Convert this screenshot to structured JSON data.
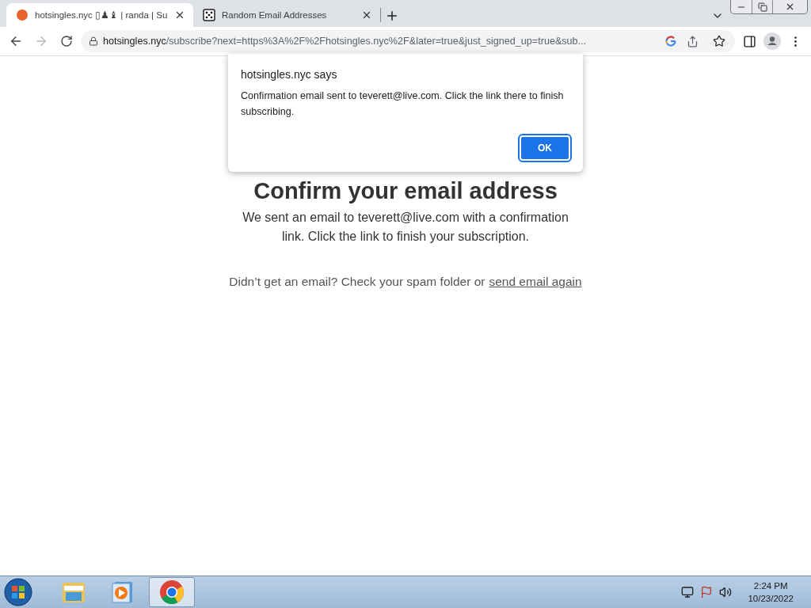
{
  "browser": {
    "tabs": [
      {
        "title": "hotsingles.nyc ▯♟♝ | randa | Su",
        "kind": "face",
        "selected": true
      },
      {
        "title": "Random Email Addresses",
        "kind": "dice",
        "selected": false
      }
    ],
    "address": {
      "host": "hotsingles.nyc",
      "path": "/subscribe?next=https%3A%2F%2Fhotsingles.nyc%2F&later=true&just_signed_up=true&sub..."
    }
  },
  "page": {
    "heading": "Confirm your email address",
    "message": "We sent an email to teverett@live.com with a confirmation link. Click the link to finish your subscription.",
    "footer": {
      "text": "Didn’t get an email? Check your spam folder or",
      "link": "send email again"
    }
  },
  "dialog": {
    "title": "hotsingles.nyc says",
    "message": "Confirmation email sent to teverett@live.com. Click the link there to finish subscribing.",
    "button": "OK"
  },
  "taskbar": {
    "apps": [
      {
        "kind": "folder",
        "selected": false
      },
      {
        "kind": "media",
        "selected": false
      },
      {
        "kind": "chrome",
        "selected": true
      }
    ],
    "time": "2:24 PM",
    "date": "10/23/2022"
  }
}
